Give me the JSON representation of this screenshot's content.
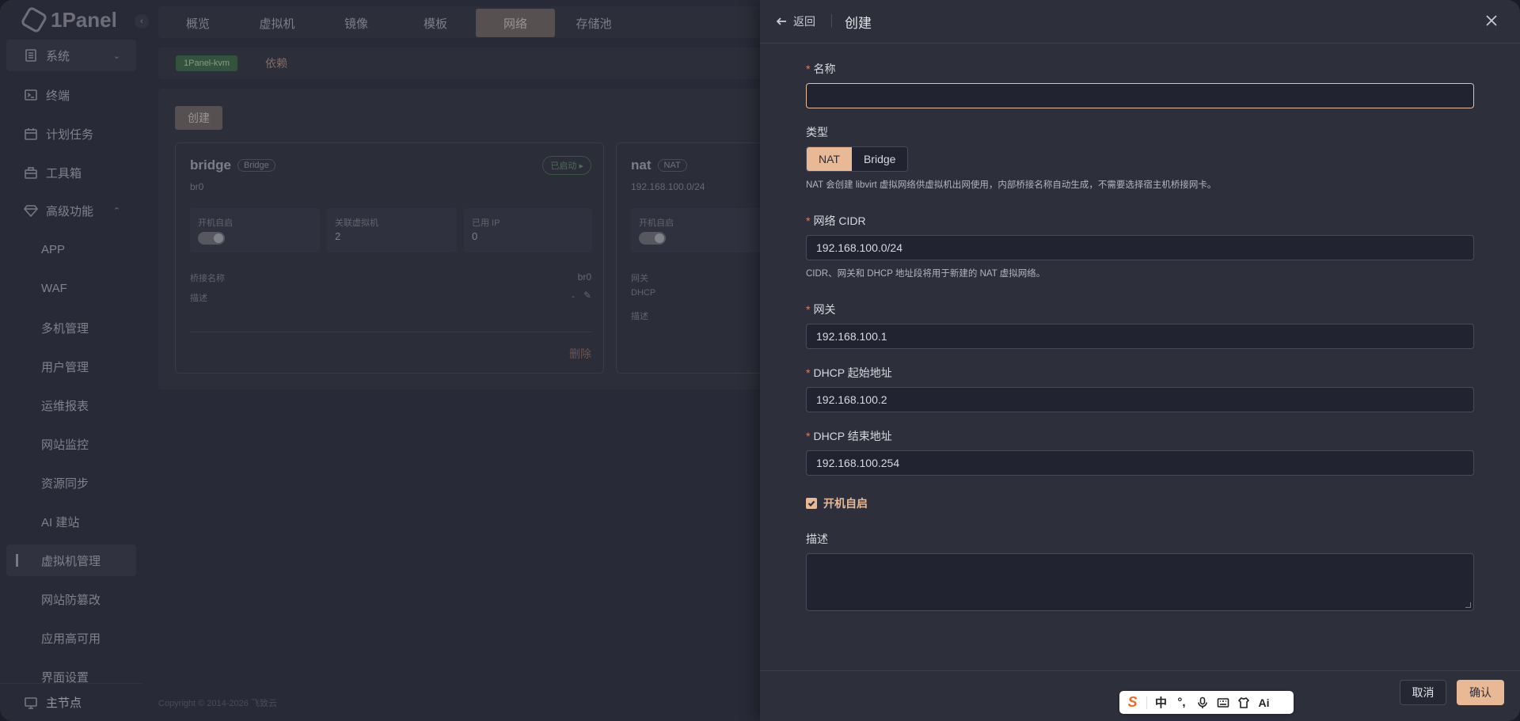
{
  "app": {
    "logo_text": "1Panel"
  },
  "sidebar": {
    "items": [
      {
        "label": "系统",
        "icon": "server-icon",
        "expand": "chevron-down"
      },
      {
        "label": "终端",
        "icon": "terminal-icon"
      },
      {
        "label": "计划任务",
        "icon": "calendar-icon"
      },
      {
        "label": "工具箱",
        "icon": "toolbox-icon"
      },
      {
        "label": "高级功能",
        "icon": "diamond-icon",
        "expand": "chevron-up"
      }
    ],
    "sub_items": [
      "APP",
      "WAF",
      "多机管理",
      "用户管理",
      "运维报表",
      "网站监控",
      "资源同步",
      "AI 建站",
      "虚拟机管理",
      "网站防篡改",
      "应用高可用",
      "界面设置"
    ],
    "active_sub": "虚拟机管理",
    "main_node": "主节点"
  },
  "tabs": [
    "概览",
    "虚拟机",
    "镜像",
    "模板",
    "网络",
    "存储池"
  ],
  "active_tab": "网络",
  "subbar": {
    "badge": "1Panel-kvm",
    "link": "依赖"
  },
  "content": {
    "create_label": "创建",
    "cards": [
      {
        "name": "bridge",
        "tag": "Bridge",
        "sub": "br0",
        "status": "已启动",
        "stats": [
          {
            "label": "开机自启",
            "value": ""
          },
          {
            "label": "关联虚拟机",
            "value": "2"
          },
          {
            "label": "已用 IP",
            "value": "0"
          }
        ],
        "rows": [
          {
            "key": "桥接名称",
            "value": "br0"
          },
          {
            "key": "描述",
            "value": "-"
          }
        ],
        "delete_label": "删除"
      },
      {
        "name": "nat",
        "tag": "NAT",
        "sub": "192.168.100.0/24",
        "stats": [
          {
            "label": "开机自启",
            "value": ""
          }
        ],
        "rows": [
          {
            "key": "网关",
            "value": ""
          },
          {
            "key": "DHCP",
            "value": ""
          },
          {
            "key": "描述",
            "value": ""
          }
        ]
      }
    ],
    "copyright": "Copyright © 2014-2026 飞致云"
  },
  "drawer": {
    "back_label": "返回",
    "title": "创建",
    "fields": {
      "name": {
        "label": "名称",
        "value": ""
      },
      "type": {
        "label": "类型",
        "options": [
          "NAT",
          "Bridge"
        ],
        "selected": "NAT",
        "hint": "NAT 会创建 libvirt 虚拟网络供虚拟机出网使用，内部桥接名称自动生成，不需要选择宿主机桥接网卡。"
      },
      "cidr": {
        "label": "网络 CIDR",
        "value": "192.168.100.0/24",
        "hint": "CIDR、网关和 DHCP 地址段将用于新建的 NAT 虚拟网络。"
      },
      "gateway": {
        "label": "网关",
        "value": "192.168.100.1"
      },
      "dhcp_start": {
        "label": "DHCP 起始地址",
        "value": "192.168.100.2"
      },
      "dhcp_end": {
        "label": "DHCP 结束地址",
        "value": "192.168.100.254"
      },
      "autostart": {
        "label": "开机自启",
        "checked": true
      },
      "description": {
        "label": "描述",
        "value": ""
      }
    },
    "footer": {
      "cancel_label": "取消",
      "confirm_label": "确认"
    }
  },
  "ime": {
    "items": [
      "sogou-logo-icon",
      "中",
      "punctuation-icon",
      "microphone-icon",
      "keyboard-icon",
      "skin-icon",
      "ai-icon"
    ]
  },
  "colors": {
    "accent": "#e9b996",
    "required": "#e07a6c",
    "panel_bg": "#2d2f3b",
    "input_bg": "#212330"
  }
}
